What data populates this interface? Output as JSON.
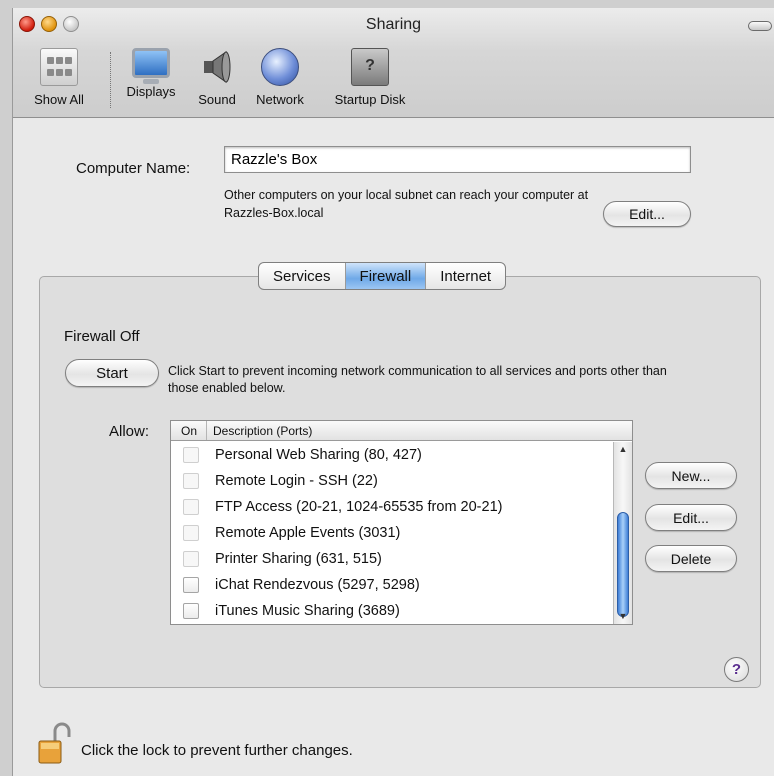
{
  "window": {
    "title": "Sharing"
  },
  "toolbar": {
    "items": [
      {
        "label": "Show All"
      },
      {
        "label": "Displays"
      },
      {
        "label": "Sound"
      },
      {
        "label": "Network"
      },
      {
        "label": "Startup Disk"
      }
    ]
  },
  "computer_name": {
    "label": "Computer Name:",
    "value": "Razzle's Box",
    "description": "Other computers on your local subnet can reach your computer at Razzles-Box.local",
    "edit_button": "Edit..."
  },
  "tabs": [
    {
      "label": "Services",
      "active": false
    },
    {
      "label": "Firewall",
      "active": true
    },
    {
      "label": "Internet",
      "active": false
    }
  ],
  "firewall": {
    "status": "Firewall Off",
    "start_button": "Start",
    "description": "Click Start to prevent incoming network communication to all services and ports other than those enabled below.",
    "allow_label": "Allow:",
    "columns": {
      "on": "On",
      "description": "Description (Ports)"
    },
    "services": [
      {
        "description": "Personal Web Sharing (80, 427)",
        "enabled": false
      },
      {
        "description": "Remote Login - SSH (22)",
        "enabled": false
      },
      {
        "description": "FTP Access (20-21, 1024-65535 from 20-21)",
        "enabled": false
      },
      {
        "description": "Remote Apple Events (3031)",
        "enabled": false
      },
      {
        "description": "Printer Sharing (631, 515)",
        "enabled": false
      },
      {
        "description": "iChat Rendezvous (5297, 5298)",
        "enabled": true
      },
      {
        "description": "iTunes Music Sharing (3689)",
        "enabled": true
      }
    ],
    "new_button": "New...",
    "edit_button": "Edit...",
    "delete_button": "Delete"
  },
  "help": {
    "label": "?"
  },
  "lock": {
    "text": "Click the lock to prevent further changes."
  },
  "colors": {
    "tab_active": "#6fa9e8",
    "scroll_thumb": "#3f7fd6"
  }
}
